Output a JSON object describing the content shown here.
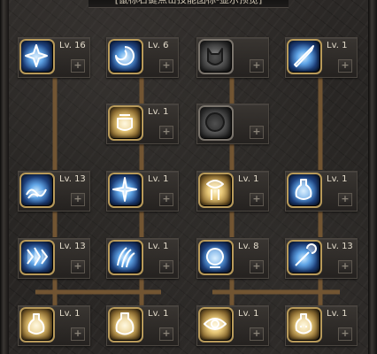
{
  "header": {
    "title": "[鼠标右键点击技能图标-显示预览]"
  },
  "colors": {
    "level_text": "#e4dccb",
    "connector": "#7a5a34",
    "frame_gold": "#b89a5a"
  },
  "skills": [
    {
      "level": "Lv. 16",
      "icon": "ice-burst-icon",
      "style": "blue"
    },
    {
      "level": "Lv. 6",
      "icon": "orb-swirl-icon",
      "style": "blue"
    },
    {
      "level": "",
      "icon": "locked-beast-icon",
      "style": "grey"
    },
    {
      "level": "Lv. 1",
      "icon": "ice-spear-icon",
      "style": "blue"
    },
    {
      "level": "Lv. 1",
      "icon": "fist-rune-icon",
      "style": "gold"
    },
    {
      "level": "",
      "icon": "locked-sphere-icon",
      "style": "grey"
    },
    {
      "level": "Lv. 13",
      "icon": "frost-wave-icon",
      "style": "blue"
    },
    {
      "level": "Lv. 1",
      "icon": "shard-nova-icon",
      "style": "blue"
    },
    {
      "level": "Lv. 1",
      "icon": "twin-shell-icon",
      "style": "gold"
    },
    {
      "level": "Lv. 1",
      "icon": "potion-flask-icon",
      "style": "blue"
    },
    {
      "level": "Lv. 13",
      "icon": "blizzard-icon",
      "style": "blue"
    },
    {
      "level": "Lv. 1",
      "icon": "ice-claw-icon",
      "style": "blue"
    },
    {
      "level": "Lv. 8",
      "icon": "crystal-orb-icon",
      "style": "blue"
    },
    {
      "level": "Lv. 13",
      "icon": "frost-wand-icon",
      "style": "blue"
    },
    {
      "level": "Lv. 1",
      "icon": "gold-flask-icon",
      "style": "gold"
    },
    {
      "level": "Lv. 1",
      "icon": "gold-potion-icon",
      "style": "gold"
    },
    {
      "level": "Lv. 1",
      "icon": "gold-eye-icon",
      "style": "gold"
    },
    {
      "level": "Lv. 1",
      "icon": "gold-skull-flask-icon",
      "style": "gold"
    }
  ],
  "plus_label": "+"
}
